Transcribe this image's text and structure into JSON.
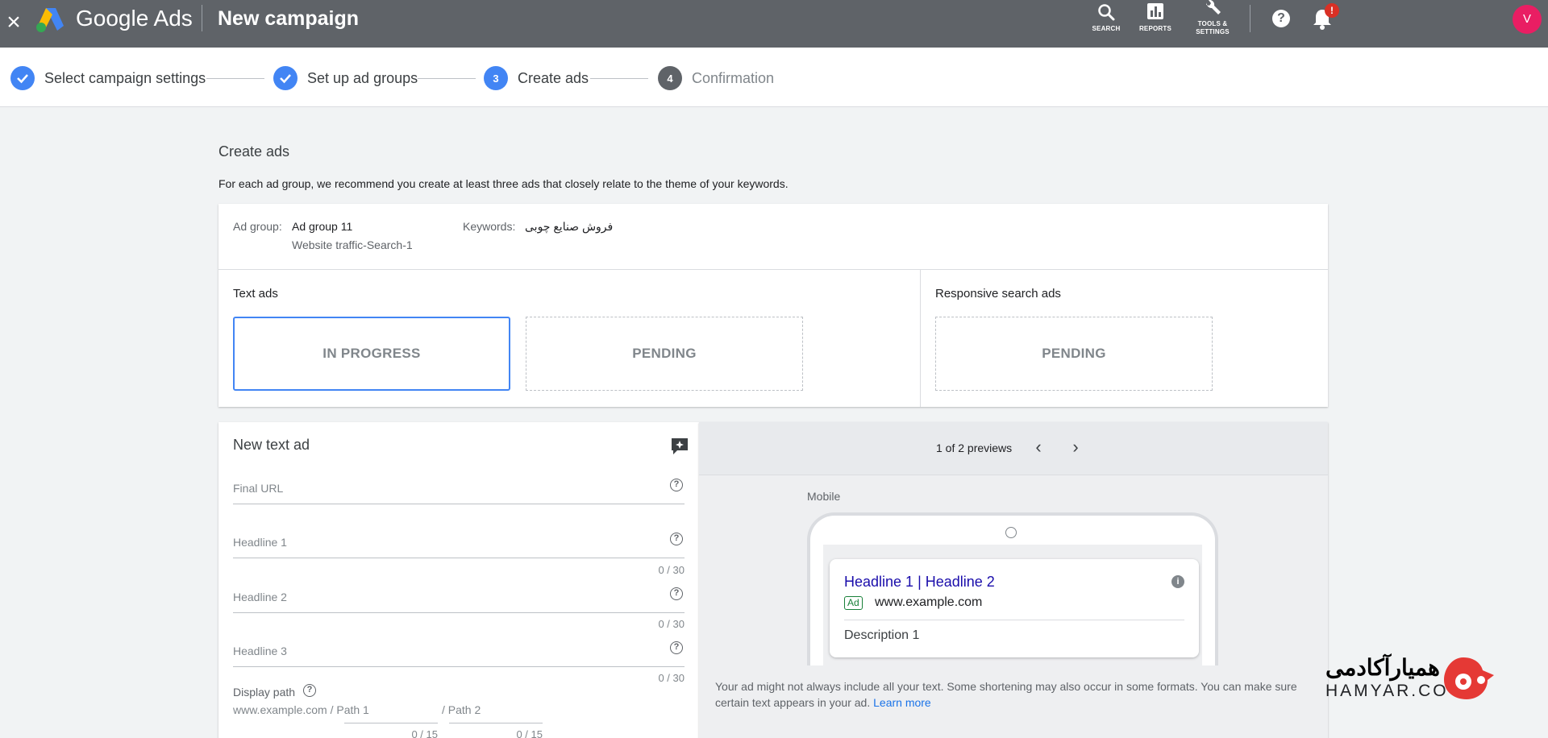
{
  "app": {
    "brand": "Google Ads",
    "page_title": "New campaign"
  },
  "topbar": {
    "tools": [
      {
        "label": "SEARCH",
        "icon": "search-icon"
      },
      {
        "label": "REPORTS",
        "icon": "reports-icon"
      },
      {
        "label_line1": "TOOLS &",
        "label_line2": "SETTINGS",
        "icon": "wrench-icon"
      }
    ],
    "help_icon": "?",
    "notification_badge": "!",
    "avatar_initial": "V"
  },
  "stepper": {
    "steps": [
      {
        "label": "Select campaign settings",
        "state": "done"
      },
      {
        "label": "Set up ad groups",
        "state": "done"
      },
      {
        "label": "Create ads",
        "state": "current",
        "number": "3"
      },
      {
        "label": "Confirmation",
        "state": "todo",
        "number": "4"
      }
    ]
  },
  "main": {
    "title": "Create ads",
    "description": "For each ad group, we recommend you create at least three ads that closely relate to the theme of your keywords."
  },
  "ad_group_info": {
    "ad_group_label": "Ad group:",
    "ad_group_value": "Ad group 11",
    "campaign_name": "Website traffic-Search-1",
    "keywords_label": "Keywords:",
    "keywords_value": "فروش صنایع چوبی"
  },
  "text_ads": {
    "title": "Text ads",
    "slots": [
      "IN PROGRESS",
      "PENDING"
    ]
  },
  "responsive_ads": {
    "title": "Responsive search ads",
    "slots": [
      "PENDING"
    ]
  },
  "form": {
    "title": "New text ad",
    "final_url_label": "Final URL",
    "headline1_label": "Headline 1",
    "headline1_counter": "0 / 30",
    "headline2_label": "Headline 2",
    "headline2_counter": "0 / 30",
    "headline3_label": "Headline 3",
    "headline3_counter": "0 / 30",
    "display_path_label": "Display path",
    "display_path_prefix": "www.example.com / Path 1",
    "path2_label": "/ Path 2",
    "path1_counter": "0 / 15",
    "path2_counter": "0 / 15"
  },
  "preview": {
    "count": "1 of 2 previews",
    "device_label": "Mobile",
    "headline": "Headline 1 | Headline 2",
    "ad_badge": "Ad",
    "url": "www.example.com",
    "description": "Description 1",
    "note": "Your ad might not always include all your text. Some shortening may also occur in some formats. You can make sure certain text appears in your ad.",
    "learn_more": "Learn more"
  },
  "watermark": {
    "text": "همیارآکادمی",
    "sub": "HAMYAR.CO"
  },
  "colors": {
    "topbar": "#5f6368",
    "accent": "#4285f4",
    "link": "#1a0dab",
    "badge": "#d93025",
    "avatar": "#e91e63"
  }
}
